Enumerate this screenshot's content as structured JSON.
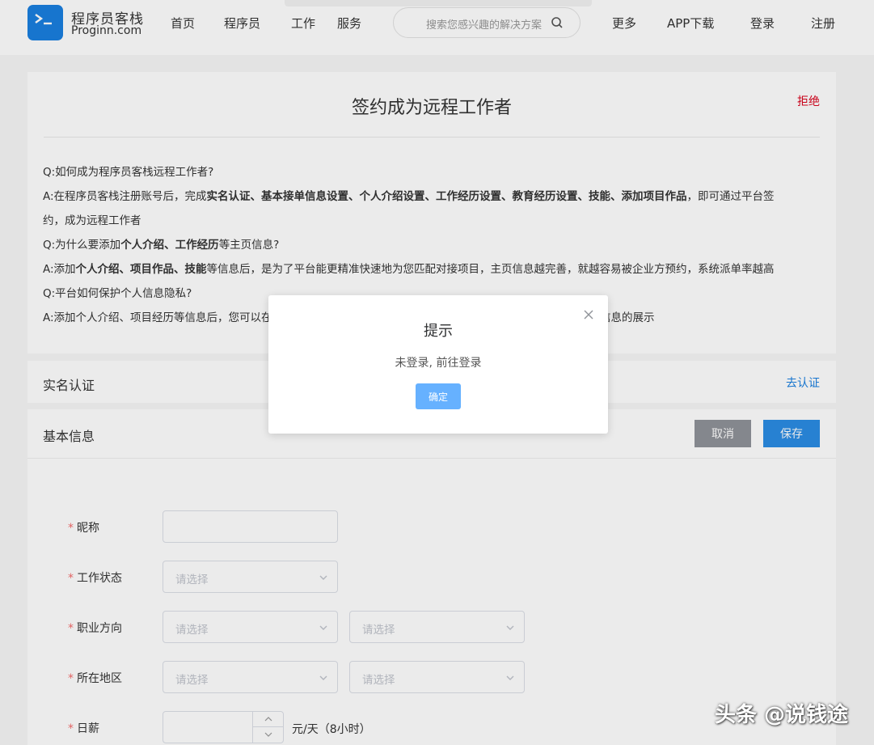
{
  "header": {
    "logo_cn": "程序员客栈",
    "logo_en": "Proginn.com",
    "nav": [
      "首页",
      "程序员",
      "工作",
      "服务",
      "更多",
      "APP下载",
      "登录",
      "注册"
    ],
    "search_placeholder": "搜索您感兴趣的解决方案"
  },
  "page": {
    "title": "签约成为远程工作者",
    "reject": "拒绝"
  },
  "faq": {
    "q1": "Q:如何成为程序员客栈远程工作者?",
    "a1_pre": "A:在程序员客栈注册账号后，完成",
    "a1_bold": "实名认证、基本接单信息设置、个人介绍设置、工作经历设置、教育经历设置、技能、添加项目作品",
    "a1_post": "，即可通过平台签",
    "a1_cont": "约，成为远程工作者",
    "q2_pre": "Q:为什么要添加",
    "q2_bold": "个人介绍、工作经历",
    "q2_post": "等主页信息?",
    "a2_pre": "A:添加",
    "a2_bold": "个人介绍、项目作品、技能",
    "a2_post": "等信息后，是为了平台能更精准快速地为您匹配对接项目，主页信息越完善，就越容易被企业方预约，系统派单率越高",
    "q3": "Q:平台如何保护个人信息隐私?",
    "a3": "A:添加个人介绍、项目经历等信息后，您可以在个人主页“设置主页信息”功能，设置主页访问密码，或选择隐藏部分信息的展示"
  },
  "auth": {
    "title": "实名认证",
    "link": "去认证"
  },
  "basic": {
    "title": "基本信息",
    "cancel": "取消",
    "save": "保存",
    "fields": {
      "nickname": "昵称",
      "work_status": "工作状态",
      "career": "职业方向",
      "region": "所在地区",
      "daily_rate": "日薪"
    },
    "select_placeholder": "请选择",
    "rate_unit": "元/天（8小时）"
  },
  "dialog": {
    "title": "提示",
    "message": "未登录, 前往登录",
    "ok": "确定"
  },
  "watermark": "头条 @说钱途",
  "colors": {
    "brand": "#1a7fe0",
    "reject": "#d9001b",
    "save": "#2b8de4",
    "cancel": "#909399",
    "dialog_ok": "#66b1ff",
    "required": "#f56c6c"
  }
}
